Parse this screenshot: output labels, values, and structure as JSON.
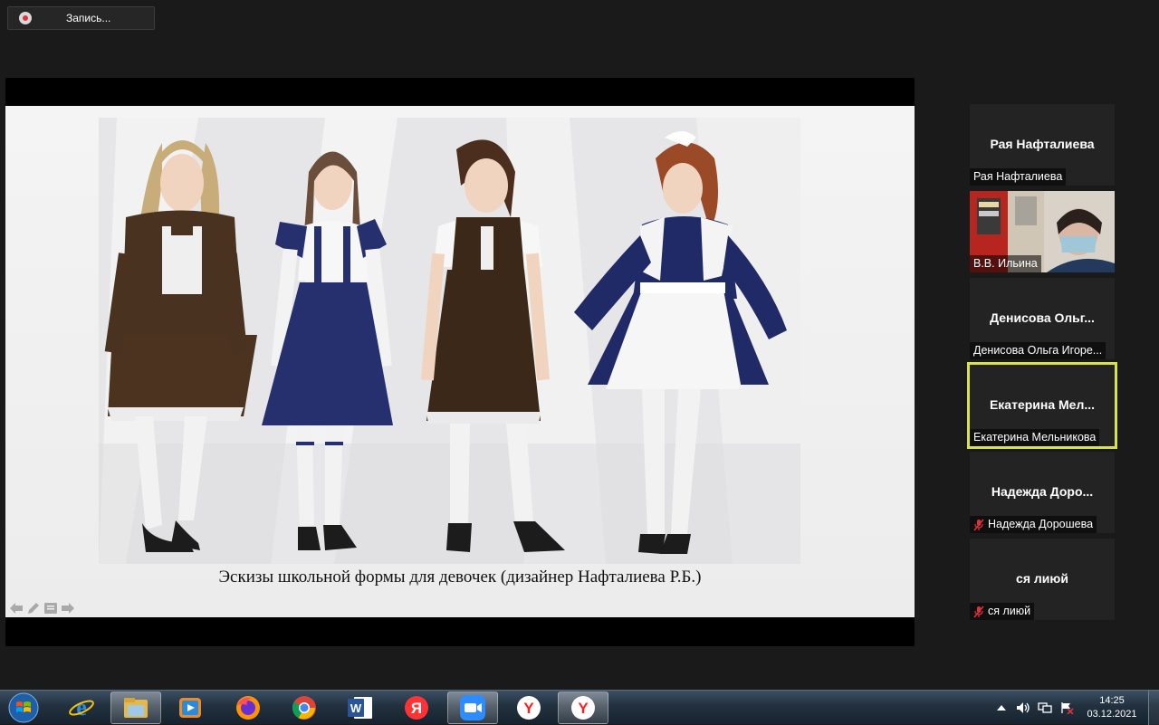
{
  "recording": {
    "label": "Запись..."
  },
  "slide": {
    "caption": "Эскизы школьной формы для девочек  (дизайнер Нафталиева Р.Б.)"
  },
  "participants": [
    {
      "display": "Рая Нафталиева",
      "name": "Рая Нафталиева",
      "muted": false,
      "video": false,
      "speaking": false
    },
    {
      "display": "",
      "name": "В.В. Ильина",
      "muted": false,
      "video": true,
      "speaking": false
    },
    {
      "display": "Денисова  Ольг...",
      "name": "Денисова Ольга Игоре...",
      "muted": false,
      "video": false,
      "speaking": false
    },
    {
      "display": "Екатерина  Мел...",
      "name": "Екатерина Мельникова",
      "muted": false,
      "video": false,
      "speaking": true
    },
    {
      "display": "Надежда  Доро...",
      "name": "Надежда Дорошева",
      "muted": true,
      "video": false,
      "speaking": false
    },
    {
      "display": "ся лиюй",
      "name": "ся лиюй",
      "muted": true,
      "video": false,
      "speaking": false
    }
  ],
  "taskbar": {
    "apps": [
      "ie-icon",
      "explorer-icon",
      "media-player-icon",
      "firefox-icon",
      "chrome-icon",
      "word-icon",
      "yandex-browser-icon",
      "zoom-icon",
      "yandex-icon",
      "yandex-icon"
    ],
    "clock": {
      "time": "14:25",
      "date": "03.12.2021"
    }
  },
  "colors": {
    "speaking_outline": "#d6e34d",
    "muted_mic": "#e0313b"
  }
}
